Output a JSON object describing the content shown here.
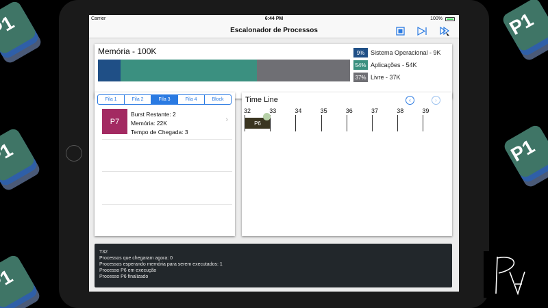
{
  "status_bar": {
    "carrier": "Carrier",
    "time": "6:44 PM",
    "battery": "100%"
  },
  "nav": {
    "title": "Escalonador de Processos",
    "buttons": [
      "stop-icon",
      "play-step-icon",
      "fast-forward-icon"
    ],
    "accent": "#2a7ae2"
  },
  "memory": {
    "title": "Memória - 100K",
    "segments": [
      {
        "name": "Sistema Operacional",
        "fraction": 0.09,
        "color": "#1f4f86"
      },
      {
        "name": "Aplicações",
        "fraction": 0.54,
        "color": "#3b9080"
      },
      {
        "name": "Livre",
        "fraction": 0.37,
        "color": "#6f6f74"
      }
    ],
    "legend": [
      {
        "pct": "9%",
        "label": "Sistema Operacional - 9K",
        "color": "#1f4f86"
      },
      {
        "pct": "54%",
        "label": "Aplicações - 54K",
        "color": "#3b9080"
      },
      {
        "pct": "37%",
        "label": "Livre - 37K",
        "color": "#6f6f74"
      }
    ]
  },
  "queue": {
    "tabs": [
      "Fila 1",
      "Fila 2",
      "Fila 3",
      "Fila 4",
      "Block"
    ],
    "active_tab": "Fila 3",
    "process": {
      "id": "P7",
      "color": "#a32a62",
      "burst": "Burst Restante: 2",
      "memory": "Memória: 22K",
      "arrival": "Tempo de Chegada: 3"
    }
  },
  "timeline": {
    "title": "Time Line",
    "labels": [
      "32",
      "33",
      "34",
      "35",
      "36",
      "37",
      "38",
      "39"
    ],
    "current_process": "P6",
    "current_process_color": "#3a3520",
    "prev_icon": "chevron-left-icon",
    "next_icon": "chevron-right-icon"
  },
  "console": {
    "lines": [
      "T32",
      "Processos que chegaram agora: 0",
      "Processos esperando memória para serem executados: 1",
      "Processo P6 em execução",
      "Processo P6 finalizado"
    ]
  },
  "background": {
    "tile_label": "P1",
    "logo": "PA"
  }
}
